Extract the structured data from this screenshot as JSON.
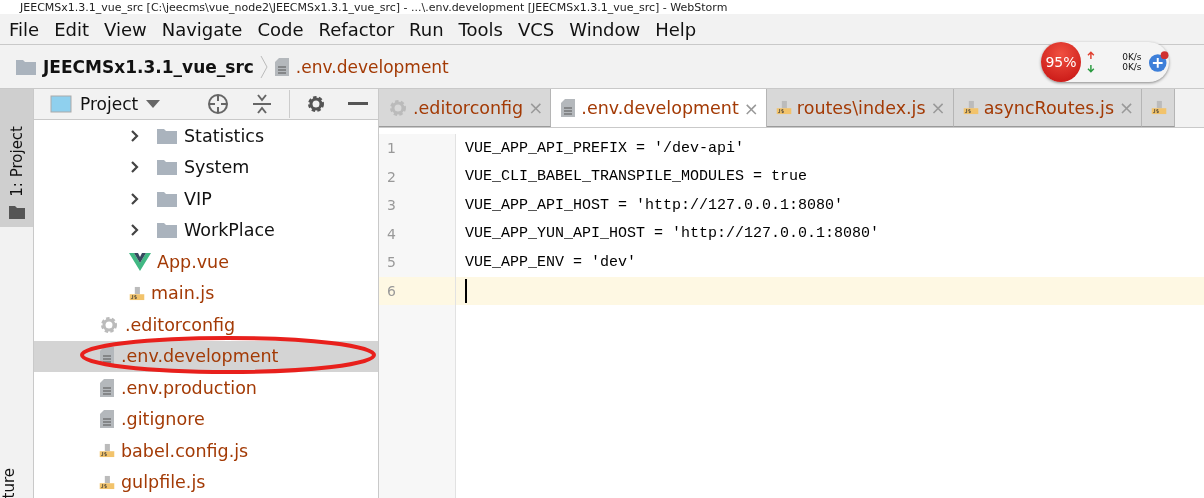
{
  "window": {
    "title": "JEECMSx1.3.1_vue_src [C:\\jeecms\\vue_node2\\JEECMSx1.3.1_vue_src] - ...\\.env.development [JEECMSx1.3.1_vue_src] - WebStorm"
  },
  "menu": [
    "File",
    "Edit",
    "View",
    "Navigate",
    "Code",
    "Refactor",
    "Run",
    "Tools",
    "VCS",
    "Window",
    "Help"
  ],
  "breadcrumb": {
    "project": "JEECMSx1.3.1_vue_src",
    "file": ".env.development"
  },
  "monitor": {
    "percent": "95%",
    "upload": "0K/s",
    "download": "0K/s"
  },
  "side_strip": {
    "top": "1: Project",
    "bottom": "ture"
  },
  "project_panel": {
    "title": "Project",
    "items": [
      {
        "kind": "folder",
        "children": [
          {
            "kind": "folder",
            "label": "Statistics",
            "selected": false
          },
          {
            "kind": "folder",
            "label": "System",
            "selected": false
          },
          {
            "kind": "folder",
            "label": "VIP",
            "selected": false
          },
          {
            "kind": "folder",
            "label": "WorkPlace",
            "selected": false
          },
          {
            "kind": "vue",
            "label": "App.vue",
            "selected": false
          },
          {
            "kind": "js",
            "label": "main.js",
            "selected": false
          }
        ]
      },
      {
        "kind": "config",
        "label": ".editorconfig",
        "selected": false
      },
      {
        "kind": "text",
        "label": ".env.development",
        "selected": true
      },
      {
        "kind": "text",
        "label": ".env.production",
        "selected": false
      },
      {
        "kind": "text",
        "label": ".gitignore",
        "selected": false
      },
      {
        "kind": "js",
        "label": "babel.config.js",
        "selected": false
      },
      {
        "kind": "js",
        "label": "gulpfile.js",
        "selected": false
      }
    ]
  },
  "tabs": [
    {
      "kind": "config",
      "label": ".editorconfig",
      "close": "×",
      "selected": false
    },
    {
      "kind": "text",
      "label": ".env.development",
      "close": "×",
      "selected": true
    },
    {
      "kind": "js",
      "label": "routes\\index.js",
      "close": "×",
      "selected": false
    },
    {
      "kind": "js",
      "label": "asyncRoutes.js",
      "close": "×",
      "selected": false
    },
    {
      "kind": "js",
      "selected": false
    }
  ],
  "editor": {
    "lines": [
      {
        "number": "1",
        "code": "VUE_APP_API_PREFIX = '/dev-api'",
        "current": false
      },
      {
        "number": "2",
        "code": "VUE_CLI_BABEL_TRANSPILE_MODULES = true",
        "current": false
      },
      {
        "number": "3",
        "code": "VUE_APP_API_HOST = 'http://127.0.0.1:8080'",
        "current": false
      },
      {
        "number": "4",
        "code": "VUE_APP_YUN_API_HOST = 'http://127.0.0.1:8080'",
        "current": false
      },
      {
        "number": "5",
        "code": "VUE_APP_ENV = 'dev'",
        "current": false
      },
      {
        "number": "6",
        "current": true
      }
    ]
  }
}
